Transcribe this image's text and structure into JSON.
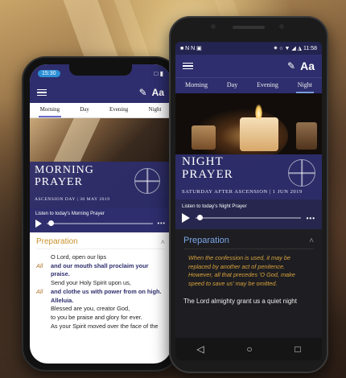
{
  "left_phone": {
    "status_time": "15:30",
    "status_icons": "□ ▮",
    "tabs": [
      "Morning",
      "Day",
      "Evening",
      "Night"
    ],
    "active_tab": 0,
    "hero_title_line1": "MORNING",
    "hero_title_line2": "PRAYER",
    "hero_subtitle": "ASCENSION DAY | 30 MAY 2019",
    "listen_caption": "Listen to today's Morning Prayer",
    "section_title": "Preparation",
    "lines": [
      {
        "lead": "",
        "text": "O Lord, open our lips",
        "response": false
      },
      {
        "lead": "All",
        "text": "and our mouth shall proclaim your praise.",
        "response": true
      },
      {
        "lead": "",
        "text": "Send your Holy Spirit upon us,",
        "response": false
      },
      {
        "lead": "All",
        "text": "and clothe us with power from on high. Alleluia.",
        "response": true
      },
      {
        "lead": "",
        "text": "Blessed are you, creator God,",
        "response": false
      },
      {
        "lead": "",
        "text": "to you be praise and glory for ever.",
        "response": false
      },
      {
        "lead": "",
        "text": "As your Spirit moved over the face of the",
        "response": false
      }
    ]
  },
  "right_phone": {
    "status_left": "■ N N ▣",
    "status_right": "✷ ○ ▼ ◢ ◮ 11:58",
    "tabs": [
      "Morning",
      "Day",
      "Evening",
      "Night"
    ],
    "active_tab": 3,
    "hero_title_line1": "NIGHT",
    "hero_title_line2": "PRAYER",
    "hero_subtitle": "SATURDAY AFTER ASCENSION | 1 JUN 2019",
    "listen_caption": "Listen to today's Night Prayer",
    "section_title": "Preparation",
    "rubric": "When the confession is used, it may be replaced by another act of penitence. However, all that precedes 'O God, make speed to save us' may be omitted.",
    "body_text": "The Lord almighty grant us a quiet night",
    "nav_back": "◁",
    "nav_home": "○",
    "nav_recent": "□"
  },
  "icons": {
    "menu": "hamburger-icon",
    "edit": "pencil-icon",
    "text_size": "Aa",
    "play": "play-icon",
    "more": "•••",
    "chevron_up": "˄"
  },
  "colors": {
    "brand": "#2e2e6e",
    "accent_gold": "#c8922e",
    "night_bg": "#1e1e22",
    "rubric_gold": "#d9a23b"
  }
}
